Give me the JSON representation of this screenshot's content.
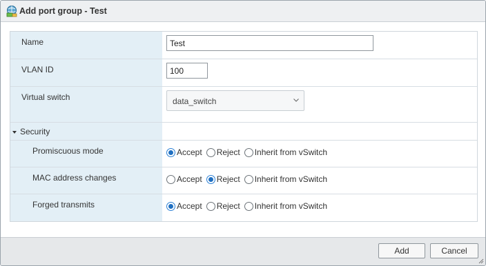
{
  "dialog": {
    "title": "Add port group - Test",
    "title_icon": "port-group-icon"
  },
  "form": {
    "name": {
      "label": "Name",
      "value": "Test"
    },
    "vlan": {
      "label": "VLAN ID",
      "value": "100"
    },
    "vswitch": {
      "label": "Virtual switch",
      "value": "data_switch"
    },
    "security": {
      "label": "Security",
      "rows": [
        {
          "label": "Promiscuous mode",
          "selected": "Accept"
        },
        {
          "label": "MAC address changes",
          "selected": "Reject"
        },
        {
          "label": "Forged transmits",
          "selected": "Accept"
        }
      ],
      "options": [
        "Accept",
        "Reject",
        "Inherit from vSwitch"
      ]
    }
  },
  "footer": {
    "add_label": "Add",
    "cancel_label": "Cancel"
  },
  "colors": {
    "label_column": "#e3eff6",
    "radio_selected": "#1f6fc1"
  }
}
